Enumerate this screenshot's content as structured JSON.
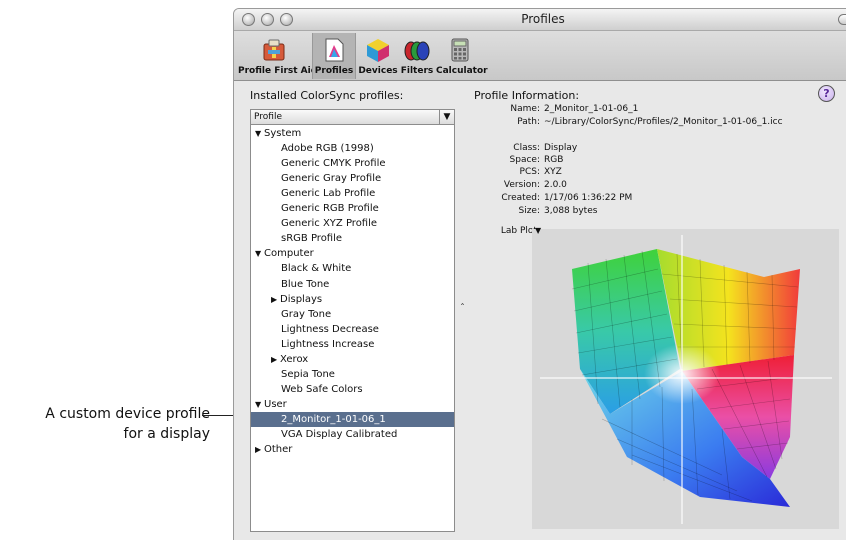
{
  "callout": {
    "line1": "A custom device profile",
    "line2": "for a display"
  },
  "window": {
    "title": "Profiles"
  },
  "toolbar": {
    "items": [
      {
        "label": "Profile First Aid",
        "icon": "first-aid-icon"
      },
      {
        "label": "Profiles",
        "icon": "profiles-icon",
        "selected": true
      },
      {
        "label": "Devices",
        "icon": "devices-icon"
      },
      {
        "label": "Filters",
        "icon": "filters-icon"
      },
      {
        "label": "Calculator",
        "icon": "calculator-icon"
      }
    ]
  },
  "installed": {
    "title": "Installed ColorSync profiles:",
    "header": "Profile",
    "rows": [
      {
        "label": "System",
        "level": 0,
        "disclosure": "open"
      },
      {
        "label": "Adobe RGB (1998)",
        "level": 2
      },
      {
        "label": "Generic CMYK Profile",
        "level": 2
      },
      {
        "label": "Generic Gray Profile",
        "level": 2
      },
      {
        "label": "Generic Lab Profile",
        "level": 2
      },
      {
        "label": "Generic RGB Profile",
        "level": 2
      },
      {
        "label": "Generic XYZ Profile",
        "level": 2
      },
      {
        "label": "sRGB Profile",
        "level": 2
      },
      {
        "label": "Computer",
        "level": 0,
        "disclosure": "open"
      },
      {
        "label": "Black & White",
        "level": 2
      },
      {
        "label": "Blue Tone",
        "level": 2
      },
      {
        "label": "Displays",
        "level": 1,
        "disclosure": "closed"
      },
      {
        "label": "Gray Tone",
        "level": 2
      },
      {
        "label": "Lightness Decrease",
        "level": 2
      },
      {
        "label": "Lightness Increase",
        "level": 2
      },
      {
        "label": "Xerox",
        "level": 1,
        "disclosure": "closed"
      },
      {
        "label": "Sepia Tone",
        "level": 2
      },
      {
        "label": "Web Safe Colors",
        "level": 2
      },
      {
        "label": "User",
        "level": 0,
        "disclosure": "open"
      },
      {
        "label": "2_Monitor_1-01-06_1",
        "level": 2,
        "selected": true
      },
      {
        "label": "VGA Display Calibrated",
        "level": 2
      },
      {
        "label": "Other",
        "level": 0,
        "disclosure": "closed"
      }
    ]
  },
  "info": {
    "title": "Profile Information:",
    "fields": [
      {
        "key": "Name:",
        "value": "2_Monitor_1-01-06_1"
      },
      {
        "key": "Path:",
        "value": "~/Library/ColorSync/Profiles/2_Monitor_1-01-06_1.icc"
      },
      {
        "key": "Class:",
        "value": "Display"
      },
      {
        "key": "Space:",
        "value": "RGB"
      },
      {
        "key": "PCS:",
        "value": "XYZ"
      },
      {
        "key": "Version:",
        "value": "2.0.0"
      },
      {
        "key": "Created:",
        "value": "1/17/06 1:36:22 PM"
      },
      {
        "key": "Size:",
        "value": "3,088 bytes"
      }
    ],
    "lab_plot_label": "Lab Plot:",
    "help_label": "?"
  },
  "colors": {
    "selection": "#5a6f8e",
    "plot_bg": "#d8d8d8"
  }
}
